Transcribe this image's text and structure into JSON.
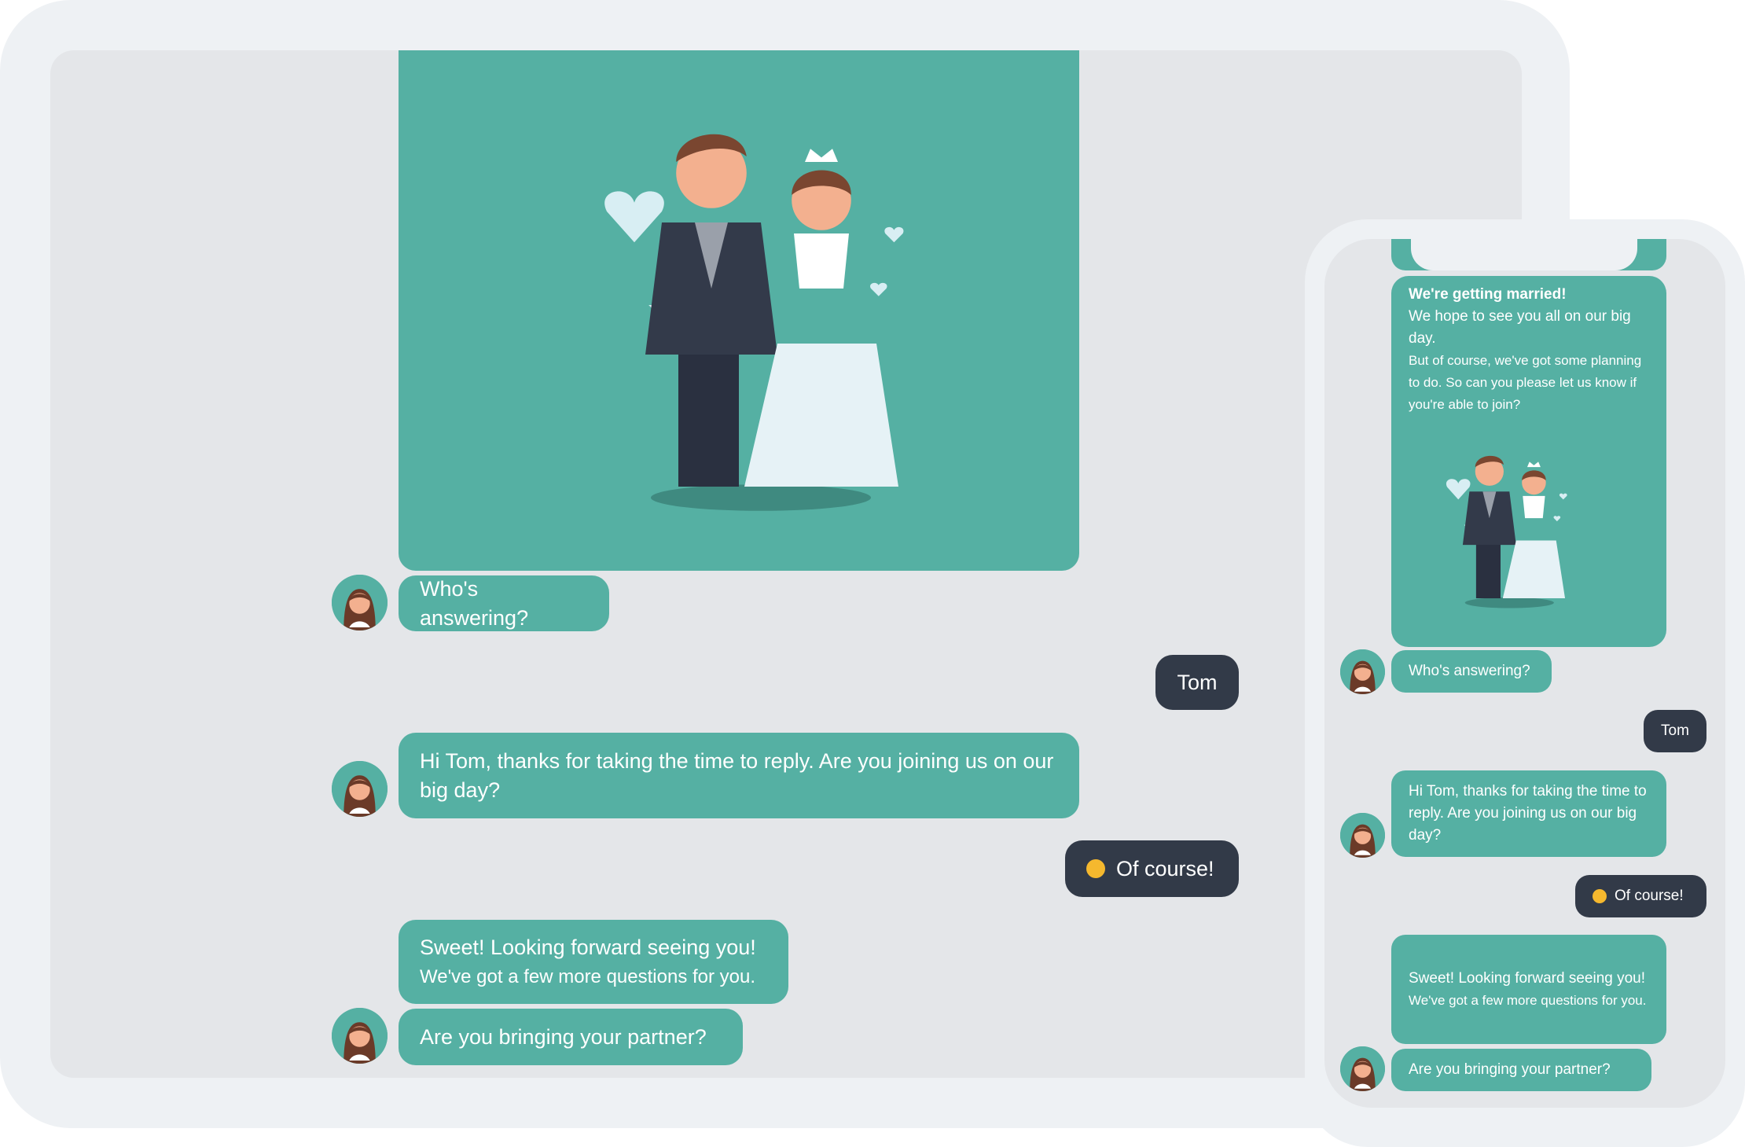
{
  "colors": {
    "bot_bubble": "#55b0a3",
    "user_bubble": "#323a48",
    "screen_bg": "#e4e6e9",
    "frame": "#eef1f4"
  },
  "tablet": {
    "messages": [
      {
        "from": "bot",
        "type": "image",
        "image": "wedding-couple-illustration"
      },
      {
        "from": "bot",
        "text": "Who's answering?"
      },
      {
        "from": "user",
        "text": "Tom"
      },
      {
        "from": "bot",
        "text": "Hi Tom, thanks for taking the time to reply. Are you joining us on our big day?"
      },
      {
        "from": "user",
        "emoji": "smiling-face-with-heart-eyes",
        "text": "Of course!"
      },
      {
        "from": "bot",
        "lines": [
          "Sweet! Looking forward seeing you!",
          "We've got a few more questions for you."
        ]
      },
      {
        "from": "bot",
        "text": "Are you bringing your partner?"
      }
    ]
  },
  "phone": {
    "intro": {
      "title": "We're getting married!",
      "line1": "We hope to see you all on our big day.",
      "line2": "But of course, we've got some planning to do. So can you please let us know if you're able to join?"
    },
    "messages": [
      {
        "from": "bot",
        "text": "Who's answering?"
      },
      {
        "from": "user",
        "text": "Tom"
      },
      {
        "from": "bot",
        "text": "Hi Tom, thanks for taking the time to reply. Are you joining us on our big day?"
      },
      {
        "from": "user",
        "emoji": "smiling-face-with-heart-eyes",
        "text": "Of course!"
      },
      {
        "from": "bot",
        "lines": [
          "Sweet! Looking forward seeing you!",
          "We've got a few more questions for you."
        ]
      },
      {
        "from": "bot",
        "text": "Are you bringing your partner?"
      }
    ]
  }
}
